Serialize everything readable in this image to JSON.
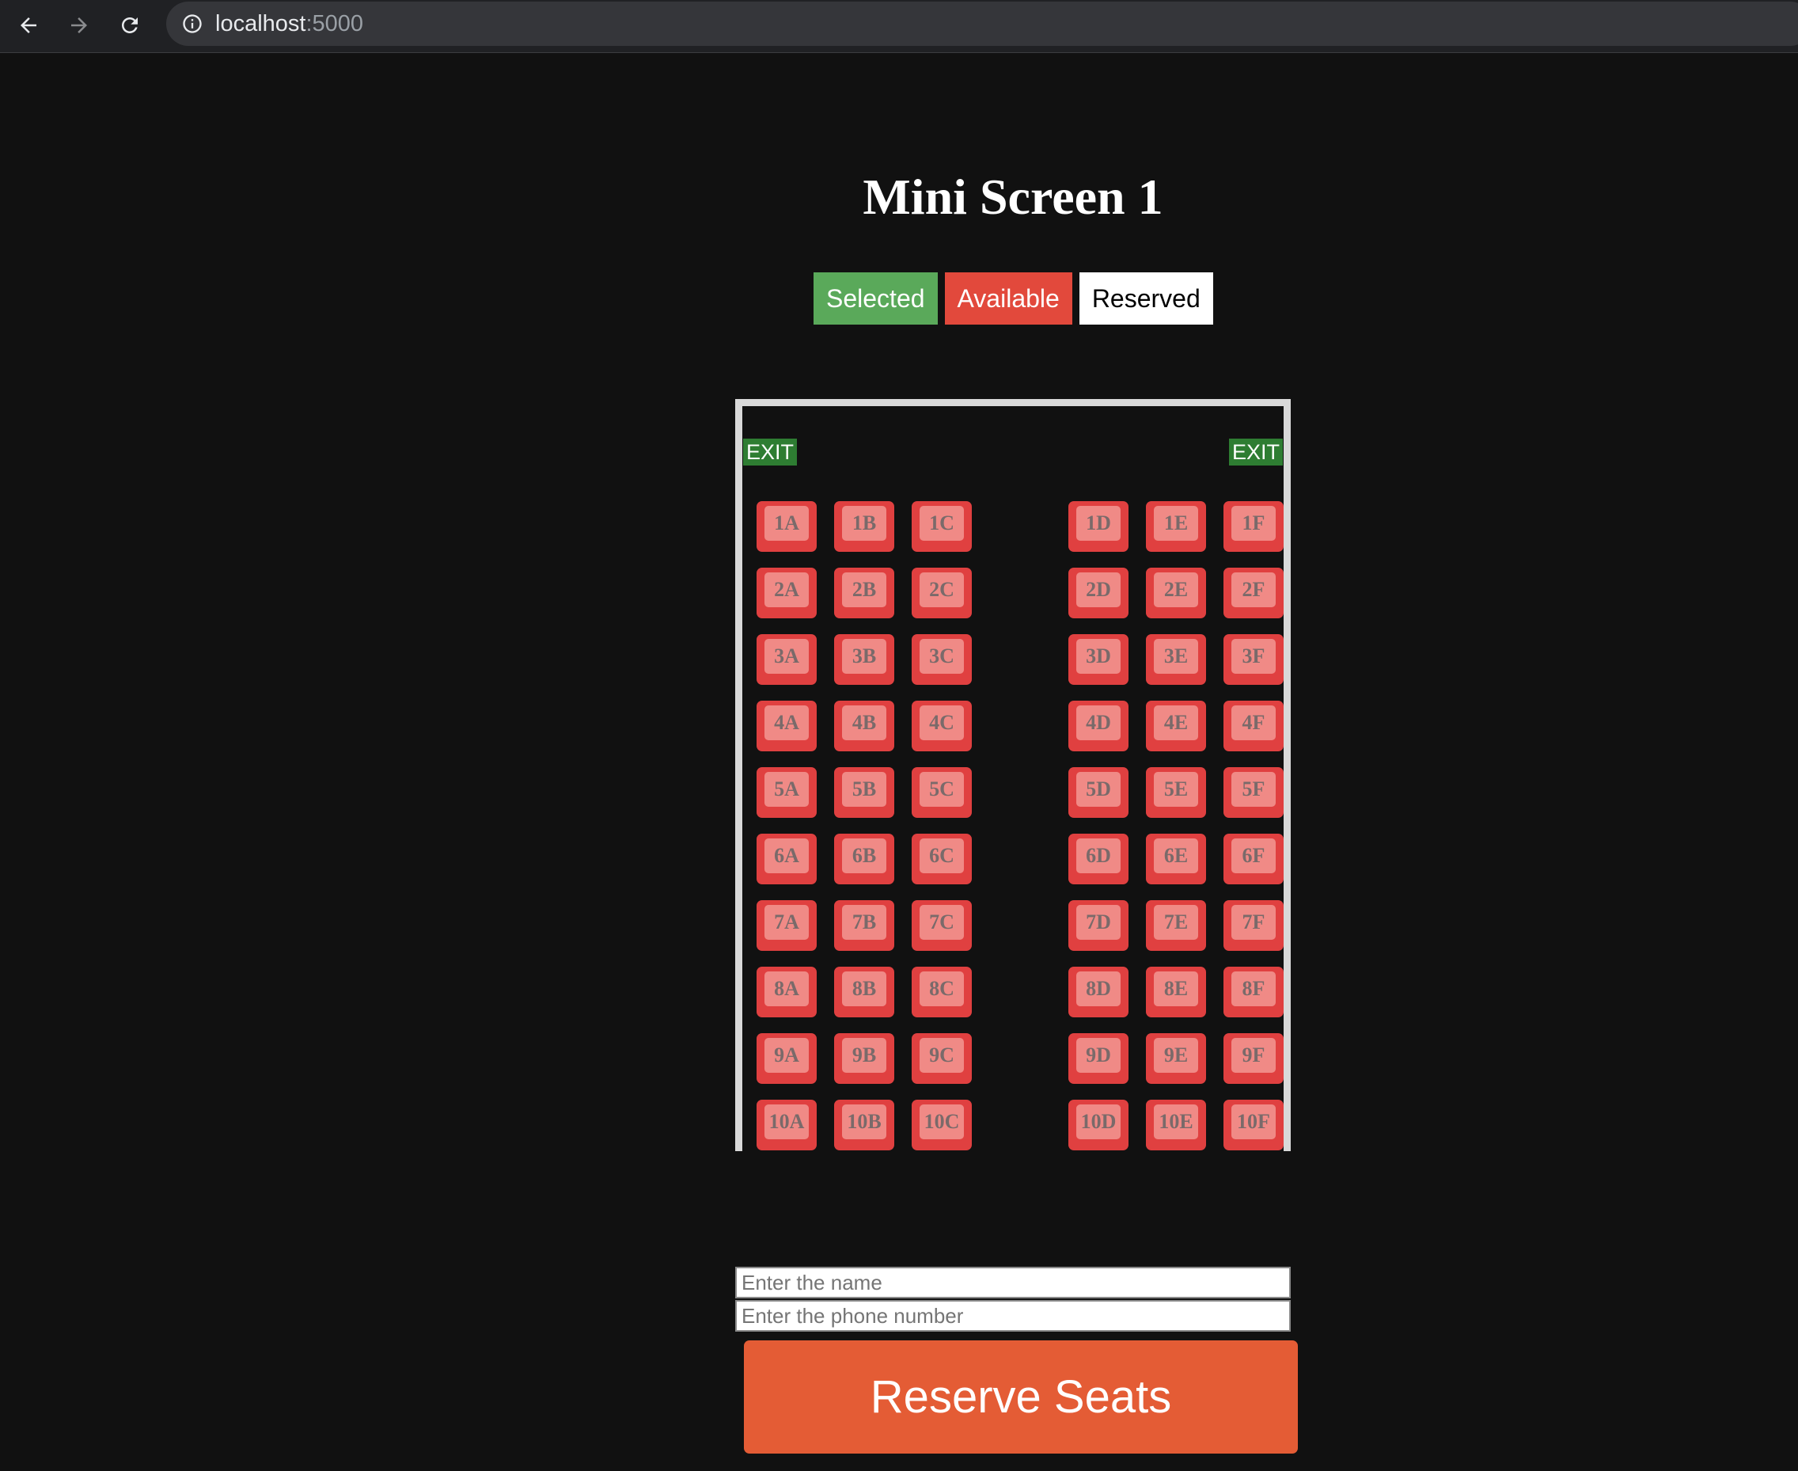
{
  "browser": {
    "url_host": "localhost",
    "url_port": ":5000"
  },
  "page": {
    "title": "Mini Screen 1"
  },
  "legend": {
    "selected": "Selected",
    "available": "Available",
    "reserved": "Reserved"
  },
  "exits": {
    "left": "EXIT",
    "right": "EXIT"
  },
  "seats": {
    "left": [
      "1A",
      "1B",
      "1C",
      "2A",
      "2B",
      "2C",
      "3A",
      "3B",
      "3C",
      "4A",
      "4B",
      "4C",
      "5A",
      "5B",
      "5C",
      "6A",
      "6B",
      "6C",
      "7A",
      "7B",
      "7C",
      "8A",
      "8B",
      "8C",
      "9A",
      "9B",
      "9C",
      "10A",
      "10B",
      "10C"
    ],
    "right": [
      "1D",
      "1E",
      "1F",
      "2D",
      "2E",
      "2F",
      "3D",
      "3E",
      "3F",
      "4D",
      "4E",
      "4F",
      "5D",
      "5E",
      "5F",
      "6D",
      "6E",
      "6F",
      "7D",
      "7E",
      "7F",
      "8D",
      "8E",
      "8F",
      "9D",
      "9E",
      "9F",
      "10D",
      "10E",
      "10F"
    ]
  },
  "form": {
    "name_placeholder": "Enter the name",
    "phone_placeholder": "Enter the phone number",
    "name_value": "",
    "phone_value": "",
    "submit_label": "Reserve Seats"
  },
  "colors": {
    "selected": "#5aa95a",
    "available": "#e2493c",
    "reserved": "#ffffff",
    "exit": "#2e7d32",
    "submit": "#e45c35"
  }
}
